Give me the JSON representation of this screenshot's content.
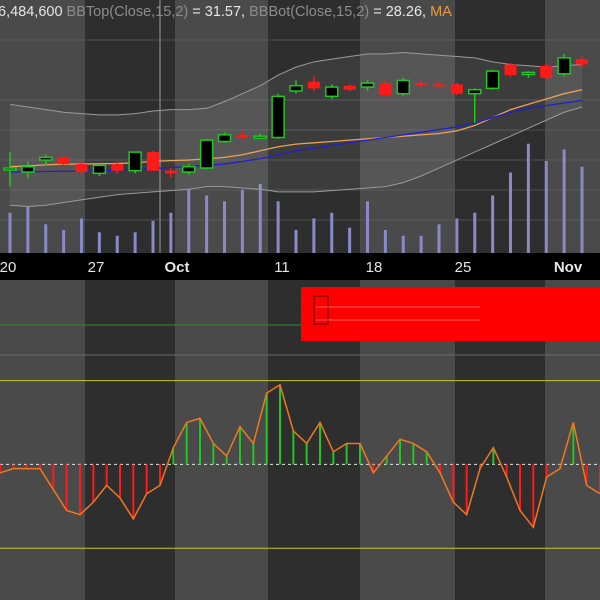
{
  "header": {
    "text_parts": [
      {
        "text": "6,484,600 ",
        "color": "#e6e6e6"
      },
      {
        "text": "BBTop(Close,15,2)",
        "color": "#8c8c8c"
      },
      {
        "text": " = 31.57, ",
        "color": "#e6e6e6"
      },
      {
        "text": "BBBot(Close,15,2)",
        "color": "#8c8c8c"
      },
      {
        "text": " = 28.26, ",
        "color": "#e6e6e6"
      },
      {
        "text": "MA",
        "color": "#e89a3c"
      }
    ]
  },
  "x_axis": {
    "labels": [
      {
        "text": "20",
        "bold": false
      },
      {
        "text": "27",
        "bold": false
      },
      {
        "text": "Oct",
        "bold": true
      },
      {
        "text": "11",
        "bold": false
      },
      {
        "text": "18",
        "bold": false
      },
      {
        "text": "25",
        "bold": false
      },
      {
        "text": "Nov",
        "bold": true
      }
    ]
  },
  "colors": {
    "up": "#22c522",
    "down": "#ff1a1a",
    "bb": "#9a9a9a",
    "ma_fast": "#e8a25a",
    "ma_slow": "#2020cc",
    "volume": "#8a8ac8",
    "oscillator": "#f07820",
    "ref_line": "#c8c820",
    "zero_line": "#2e8b2e",
    "overlay": "#ff0000"
  },
  "chart_data": [
    {
      "type": "candlestick",
      "title": "",
      "y_range": [
        24.5,
        33.2
      ],
      "candles": [
        {
          "o": 27.7,
          "h": 28.3,
          "l": 27.0,
          "c": 27.7
        },
        {
          "o": 27.55,
          "h": 27.95,
          "l": 27.3,
          "c": 27.75
        },
        {
          "o": 28.0,
          "h": 28.2,
          "l": 27.8,
          "c": 28.1
        },
        {
          "o": 28.1,
          "h": 28.2,
          "l": 27.75,
          "c": 27.85
        },
        {
          "o": 27.85,
          "h": 27.95,
          "l": 27.4,
          "c": 27.55
        },
        {
          "o": 27.5,
          "h": 27.85,
          "l": 27.4,
          "c": 27.8
        },
        {
          "o": 27.85,
          "h": 27.95,
          "l": 27.5,
          "c": 27.6
        },
        {
          "o": 27.6,
          "h": 28.3,
          "l": 27.5,
          "c": 28.3
        },
        {
          "o": 28.3,
          "h": 28.35,
          "l": 27.6,
          "c": 27.6
        },
        {
          "o": 27.6,
          "h": 27.7,
          "l": 27.35,
          "c": 27.5
        },
        {
          "o": 27.55,
          "h": 27.85,
          "l": 27.45,
          "c": 27.75
        },
        {
          "o": 27.7,
          "h": 28.8,
          "l": 27.65,
          "c": 28.75
        },
        {
          "o": 28.7,
          "h": 29.05,
          "l": 28.65,
          "c": 28.95
        },
        {
          "o": 28.95,
          "h": 29.1,
          "l": 28.8,
          "c": 28.85
        },
        {
          "o": 28.85,
          "h": 29.0,
          "l": 28.8,
          "c": 28.9
        },
        {
          "o": 28.85,
          "h": 30.5,
          "l": 28.8,
          "c": 30.4
        },
        {
          "o": 30.6,
          "h": 31.0,
          "l": 30.5,
          "c": 30.8
        },
        {
          "o": 30.95,
          "h": 31.15,
          "l": 30.6,
          "c": 30.7
        },
        {
          "o": 30.4,
          "h": 30.85,
          "l": 30.3,
          "c": 30.75
        },
        {
          "o": 30.8,
          "h": 30.85,
          "l": 30.6,
          "c": 30.65
        },
        {
          "o": 30.75,
          "h": 31.0,
          "l": 30.6,
          "c": 30.9
        },
        {
          "o": 30.9,
          "h": 31.05,
          "l": 30.4,
          "c": 30.45
        },
        {
          "o": 30.5,
          "h": 31.1,
          "l": 30.4,
          "c": 31.0
        },
        {
          "o": 30.9,
          "h": 31.0,
          "l": 30.75,
          "c": 30.85
        },
        {
          "o": 30.85,
          "h": 30.95,
          "l": 30.75,
          "c": 30.8
        },
        {
          "o": 30.85,
          "h": 30.9,
          "l": 30.45,
          "c": 30.5
        },
        {
          "o": 30.5,
          "h": 30.7,
          "l": 29.4,
          "c": 30.65
        },
        {
          "o": 30.7,
          "h": 31.4,
          "l": 30.65,
          "c": 31.35
        },
        {
          "o": 31.6,
          "h": 31.65,
          "l": 31.15,
          "c": 31.2
        },
        {
          "o": 31.25,
          "h": 31.35,
          "l": 31.1,
          "c": 31.3
        },
        {
          "o": 31.55,
          "h": 31.6,
          "l": 31.05,
          "c": 31.1
        },
        {
          "o": 31.25,
          "h": 32.0,
          "l": 31.15,
          "c": 31.85
        },
        {
          "o": 31.8,
          "h": 31.9,
          "l": 31.5,
          "c": 31.6
        }
      ],
      "bb_top": [
        30.1,
        30.0,
        29.9,
        29.8,
        29.75,
        29.7,
        29.7,
        29.75,
        29.85,
        29.9,
        29.9,
        29.95,
        30.2,
        30.5,
        30.8,
        31.2,
        31.5,
        31.7,
        31.8,
        31.9,
        32.0,
        32.0,
        32.05,
        32.0,
        31.95,
        31.9,
        31.85,
        31.7,
        31.6,
        31.55,
        31.5,
        31.55,
        31.6
      ],
      "bb_bot": [
        26.3,
        26.25,
        26.3,
        26.4,
        26.5,
        26.6,
        26.7,
        26.75,
        26.8,
        26.85,
        26.9,
        27.0,
        27.0,
        26.95,
        26.9,
        26.8,
        26.8,
        26.8,
        26.85,
        26.9,
        26.95,
        27.0,
        27.15,
        27.4,
        27.7,
        28.0,
        28.3,
        28.6,
        28.9,
        29.2,
        29.5,
        29.8,
        30.0
      ],
      "ma_fast": [
        27.75,
        27.78,
        27.82,
        27.85,
        27.85,
        27.86,
        27.87,
        27.9,
        27.95,
        27.98,
        28.0,
        28.05,
        28.1,
        28.2,
        28.35,
        28.5,
        28.6,
        28.65,
        28.7,
        28.75,
        28.8,
        28.85,
        28.9,
        28.95,
        29.0,
        29.1,
        29.3,
        29.6,
        29.9,
        30.1,
        30.3,
        30.5,
        30.65
      ],
      "ma_slow": [
        27.55,
        27.56,
        27.57,
        27.58,
        27.58,
        27.6,
        27.62,
        27.65,
        27.68,
        27.72,
        27.76,
        27.8,
        27.85,
        27.95,
        28.05,
        28.2,
        28.35,
        28.45,
        28.55,
        28.65,
        28.75,
        28.85,
        28.95,
        29.05,
        29.15,
        29.25,
        29.4,
        29.6,
        29.8,
        29.95,
        30.05,
        30.15,
        30.25
      ],
      "volume": [
        0.35,
        0.4,
        0.25,
        0.2,
        0.3,
        0.18,
        0.15,
        0.18,
        0.28,
        0.35,
        0.55,
        0.5,
        0.45,
        0.55,
        0.6,
        0.45,
        0.2,
        0.3,
        0.35,
        0.22,
        0.45,
        0.2,
        0.15,
        0.15,
        0.25,
        0.3,
        0.35,
        0.5,
        0.7,
        0.95,
        0.8,
        0.9,
        0.75
      ]
    },
    {
      "type": "line",
      "title": "",
      "y_range": [
        -120,
        220
      ],
      "ref_lines": [
        100,
        0,
        -100
      ],
      "values": [
        -10,
        -5,
        -5,
        -5,
        -30,
        -55,
        -60,
        -45,
        -25,
        -40,
        -65,
        -35,
        -25,
        20,
        50,
        55,
        25,
        10,
        45,
        25,
        85,
        95,
        40,
        25,
        50,
        15,
        25,
        25,
        -10,
        10,
        30,
        25,
        15,
        -10,
        -45,
        -60,
        -5,
        20,
        -15,
        -55,
        -75,
        -15,
        -5,
        50,
        -25,
        -35
      ]
    }
  ],
  "overlay": {
    "label": "red-overlay-box"
  }
}
